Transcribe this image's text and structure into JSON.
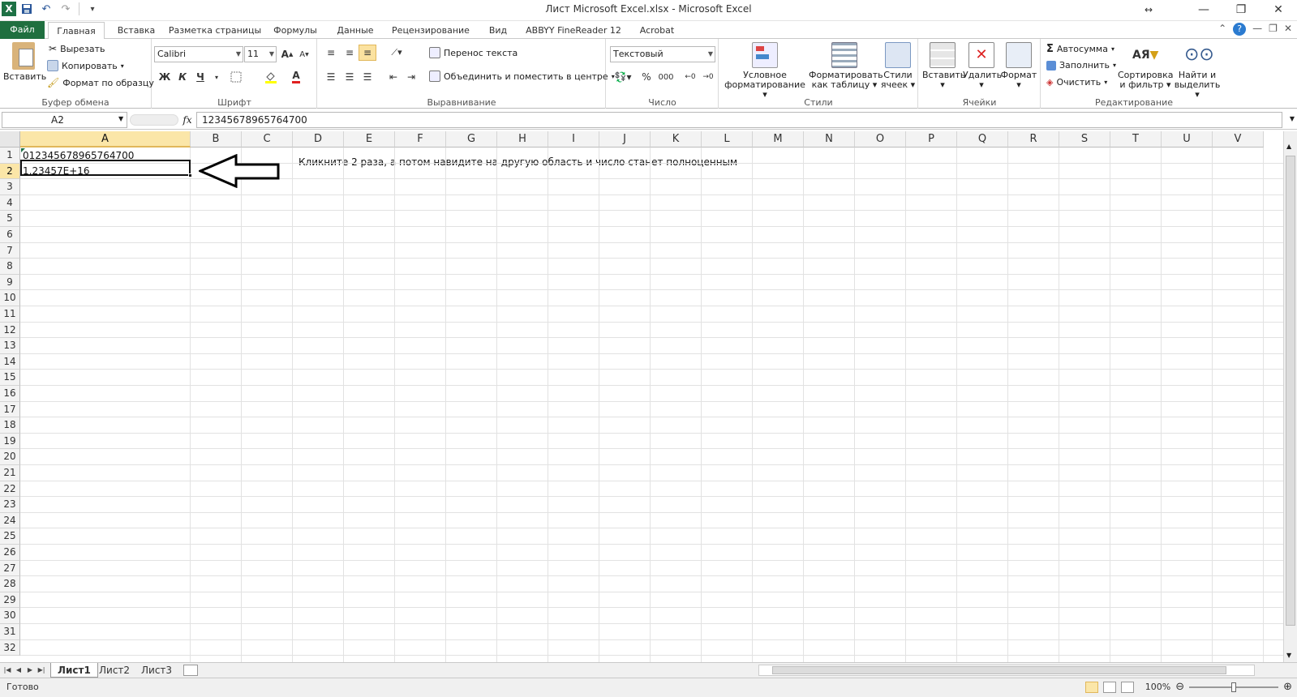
{
  "window": {
    "title": "Лист Microsoft Excel.xlsx  -  Microsoft Excel"
  },
  "ribbon_tabs": [
    "Файл",
    "Главная",
    "Вставка",
    "Разметка страницы",
    "Формулы",
    "Данные",
    "Рецензирование",
    "Вид",
    "ABBYY FineReader 12",
    "Acrobat"
  ],
  "clipboard": {
    "paste": "Вставить",
    "cut": "Вырезать",
    "copy": "Копировать",
    "format_painter": "Формат по образцу",
    "group": "Буфер обмена"
  },
  "font": {
    "name": "Calibri",
    "size": "11",
    "bold": "Ж",
    "italic": "К",
    "underline": "Ч",
    "group": "Шрифт"
  },
  "alignment": {
    "wrap": "Перенос текста",
    "merge": "Объединить и поместить в центре",
    "group": "Выравнивание"
  },
  "number": {
    "format": "Текстовый",
    "percent": "%",
    "thousands": "000",
    "group": "Число"
  },
  "styles": {
    "conditional_l1": "Условное",
    "conditional_l2": "форматирование",
    "table_l1": "Форматировать",
    "table_l2": "как таблицу",
    "cell_l1": "Стили",
    "cell_l2": "ячеек",
    "group": "Стили"
  },
  "cells": {
    "insert": "Вставить",
    "delete": "Удалить",
    "format": "Формат",
    "group": "Ячейки"
  },
  "editing": {
    "autosum": "Автосумма",
    "fill": "Заполнить",
    "clear": "Очистить",
    "sort_l1": "Сортировка",
    "sort_l2": "и фильтр",
    "find_l1": "Найти и",
    "find_l2": "выделить",
    "group": "Редактирование"
  },
  "formula_bar": {
    "name_box": "A2",
    "fx": "fx",
    "value": "12345678965764700"
  },
  "columns": [
    "A",
    "B",
    "C",
    "D",
    "E",
    "F",
    "G",
    "H",
    "I",
    "J",
    "K",
    "L",
    "M",
    "N",
    "O",
    "P",
    "Q",
    "R",
    "S",
    "T",
    "U",
    "V"
  ],
  "rows": [
    "1",
    "2",
    "3",
    "4",
    "5",
    "6",
    "7",
    "8",
    "9",
    "10",
    "11",
    "12",
    "13",
    "14",
    "15",
    "16",
    "17",
    "18",
    "19",
    "20",
    "21",
    "22",
    "23",
    "24",
    "25",
    "26",
    "27",
    "28",
    "29",
    "30",
    "31",
    "32"
  ],
  "grid": {
    "a1": "012345678965764700",
    "a2": "1,23457E+16",
    "note": "Кликните 2 раза, а потом навидите на другую область и число станет полноценным"
  },
  "sheet_tabs": [
    "Лист1",
    "Лист2",
    "Лист3"
  ],
  "status": {
    "ready": "Готово",
    "zoom": "100%"
  },
  "colors": {
    "file_tab": "#1f6f3f",
    "active_header": "#fbe6a8"
  }
}
